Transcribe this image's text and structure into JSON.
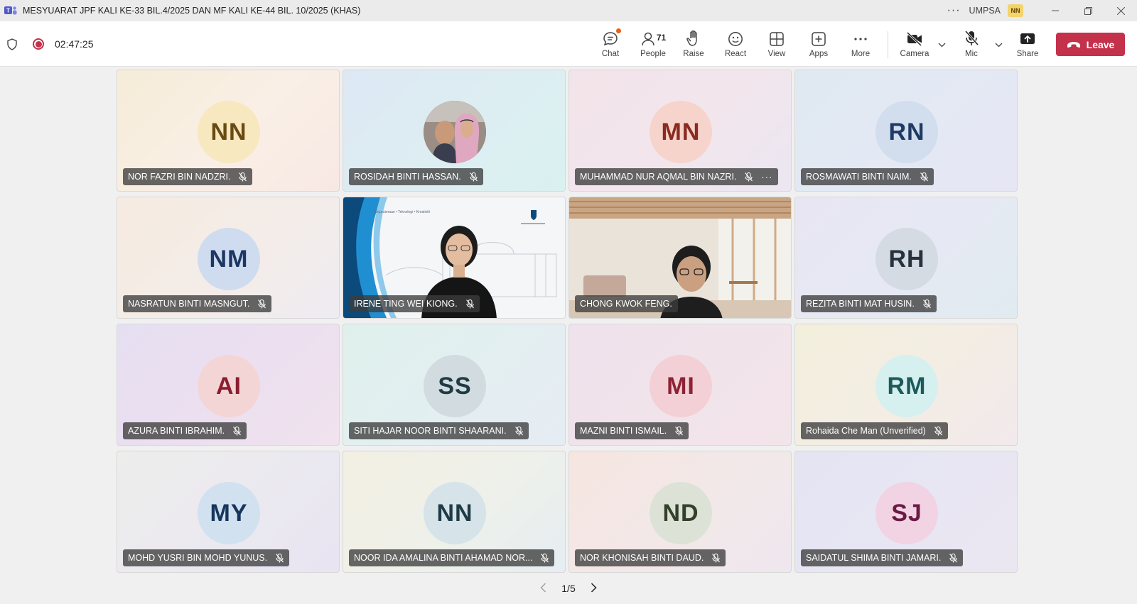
{
  "window": {
    "title": "MESYUARAT JPF KALI KE-33 BIL.4/2025 DAN MF KALI KE-44 BIL. 10/2025 (KHAS)",
    "org": "UMPSA",
    "user_initials": "NN"
  },
  "toolbar": {
    "timer": "02:47:25",
    "chat_label": "Chat",
    "people_label": "People",
    "people_count": "71",
    "raise_label": "Raise",
    "react_label": "React",
    "view_label": "View",
    "apps_label": "Apps",
    "more_label": "More",
    "camera_label": "Camera",
    "mic_label": "Mic",
    "share_label": "Share",
    "leave_label": "Leave"
  },
  "participants": [
    {
      "initials": "NN",
      "name": "NOR FAZRI BIN NADZRI."
    },
    {
      "initials": "",
      "name": "ROSIDAH BINTI HASSAN."
    },
    {
      "initials": "MN",
      "name": "MUHAMMAD NUR AQMAL BIN NAZRI."
    },
    {
      "initials": "RN",
      "name": "ROSMAWATI BINTI NAIM."
    },
    {
      "initials": "NM",
      "name": "NASRATUN BINTI MASNGUT."
    },
    {
      "initials": "",
      "name": "IRENE TING WEI KIONG."
    },
    {
      "initials": "",
      "name": "CHONG KWOK FENG."
    },
    {
      "initials": "RH",
      "name": "REZITA BINTI MAT HUSIN."
    },
    {
      "initials": "AI",
      "name": "AZURA BINTI IBRAHIM."
    },
    {
      "initials": "SS",
      "name": "SITI HAJAR NOOR BINTI SHAARANI."
    },
    {
      "initials": "MI",
      "name": "MAZNI BINTI ISMAIL."
    },
    {
      "initials": "RM",
      "name": "Rohaida Che Man (Unverified)"
    },
    {
      "initials": "MY",
      "name": "MOHD YUSRI BIN MOHD YUNUS."
    },
    {
      "initials": "NN",
      "name": "NOOR IDA AMALINA BINTI AHAMAD NOR..."
    },
    {
      "initials": "ND",
      "name": "NOR KHONISAH BINTI DAUD."
    },
    {
      "initials": "SJ",
      "name": "SAIDATUL SHIMA BINTI JAMARI."
    }
  ],
  "presentation": {
    "slide_header": "Kejuruteraan • Teknologi • Kreativiti"
  },
  "pager": {
    "label": "1/5"
  }
}
